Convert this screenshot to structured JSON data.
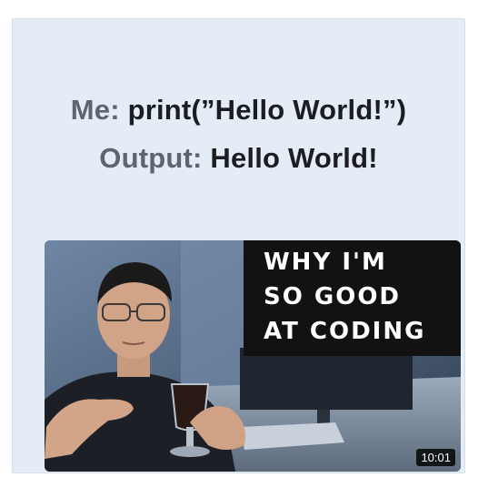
{
  "meme": {
    "line1_speaker": "Me:",
    "line1_text": "print(”Hello World!”)",
    "line2_speaker": "Output:",
    "line2_text": "Hello World!"
  },
  "video": {
    "title_lines": [
      "WHY I'M",
      "SO GOOD",
      "AT CODING"
    ],
    "duration": "10:01"
  },
  "colors": {
    "card_background": "#e4edf6",
    "speaker_text": "#5d6670",
    "main_text": "#1b1d21",
    "title_box": "#121212"
  }
}
